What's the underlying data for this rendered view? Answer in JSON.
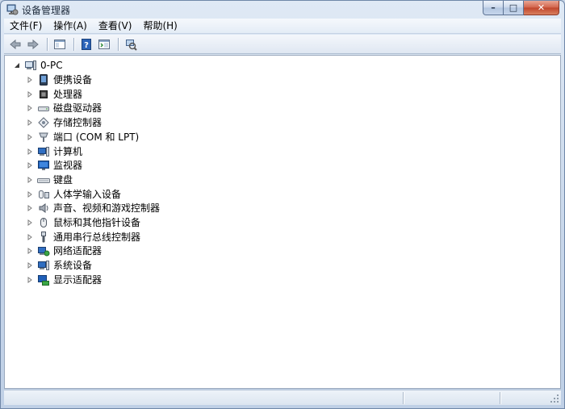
{
  "window": {
    "title": "设备管理器"
  },
  "caption": {
    "minimize": "–",
    "maximize": "□",
    "close": "✕"
  },
  "menu": [
    "文件(F)",
    "操作(A)",
    "查看(V)",
    "帮助(H)"
  ],
  "toolbar": {
    "buttons": [
      "back-icon",
      "forward-icon",
      "show-hide-console-tree-icon",
      "help-icon",
      "properties-icon",
      "scan-hardware-icon"
    ]
  },
  "tree": {
    "root": {
      "label": "0-PC",
      "icon": "computer-icon"
    },
    "items": [
      {
        "label": "便携设备",
        "icon": "portable-device-icon"
      },
      {
        "label": "处理器",
        "icon": "processor-icon"
      },
      {
        "label": "磁盘驱动器",
        "icon": "disk-drive-icon"
      },
      {
        "label": "存储控制器",
        "icon": "storage-controller-icon"
      },
      {
        "label": "端口 (COM 和 LPT)",
        "icon": "port-icon"
      },
      {
        "label": "计算机",
        "icon": "computer-icon"
      },
      {
        "label": "监视器",
        "icon": "monitor-icon"
      },
      {
        "label": "键盘",
        "icon": "keyboard-icon"
      },
      {
        "label": "人体学输入设备",
        "icon": "hid-icon"
      },
      {
        "label": "声音、视频和游戏控制器",
        "icon": "sound-icon"
      },
      {
        "label": "鼠标和其他指针设备",
        "icon": "mouse-icon"
      },
      {
        "label": "通用串行总线控制器",
        "icon": "usb-icon"
      },
      {
        "label": "网络适配器",
        "icon": "network-adapter-icon"
      },
      {
        "label": "系统设备",
        "icon": "system-device-icon"
      },
      {
        "label": "显示适配器",
        "icon": "display-adapter-icon"
      }
    ]
  }
}
